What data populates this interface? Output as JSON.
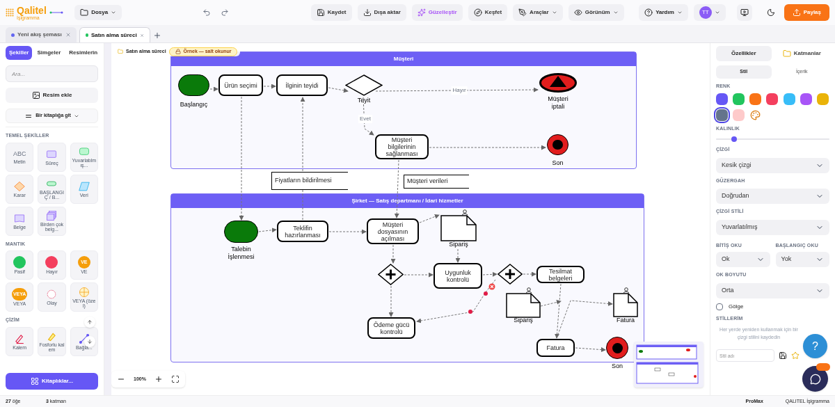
{
  "app": {
    "logo": "Qalitel",
    "logo_sub": "İşigramma"
  },
  "toolbar": {
    "file_menu": "Dosya",
    "actions": [
      {
        "label": "Kaydet",
        "kind": "save",
        "menu": false
      },
      {
        "label": "Dışa aktar",
        "kind": "export",
        "menu": false
      },
      {
        "label": "Güzelleştir",
        "kind": "beautify",
        "menu": false
      },
      {
        "label": "Keşfet",
        "kind": "explore",
        "menu": false
      },
      {
        "label": "Araçlar",
        "kind": "tools",
        "menu": true
      },
      {
        "label": "Görünüm",
        "kind": "view",
        "menu": true
      }
    ],
    "help": "Yardım",
    "avatar": "TT",
    "share": "Paylaş"
  },
  "doc_tabs": [
    {
      "label": "Yeni akış şeması",
      "color": "#6366f1",
      "selected": false
    },
    {
      "label": "Satın alma süreci",
      "color": "#22c55e",
      "selected": true
    }
  ],
  "sidebar": {
    "tabs": [
      {
        "label": "Şekiller",
        "selected": true
      },
      {
        "label": "Simgeler",
        "selected": false
      },
      {
        "label": "Resimlerin",
        "selected": false
      }
    ],
    "search": {
      "placeholder": "Ara..."
    },
    "add_image": "Resim ekle",
    "library_picker": "Bir kitaplığa git",
    "sections": [
      {
        "title": "TEMEL ŞEKİLLER",
        "items": [
          {
            "kind": "text",
            "label": "Metin",
            "glyph": "ABC"
          },
          {
            "kind": "rect",
            "label": "Süreç"
          },
          {
            "kind": "rounded",
            "label": "Yuvarlatılmış..."
          },
          {
            "kind": "diamond",
            "label": "Karar"
          },
          {
            "kind": "terminal",
            "label": "BAŞLANGIÇ / B..."
          },
          {
            "kind": "parallelogram",
            "label": "Veri"
          },
          {
            "kind": "doc",
            "label": "Belge"
          },
          {
            "kind": "multidoc",
            "label": "Birden çok belg..."
          }
        ]
      },
      {
        "title": "MANTIK",
        "items": [
          {
            "kind": "chip",
            "label": "Pasif",
            "color": "#22c55e"
          },
          {
            "kind": "chip",
            "label": "Hayır",
            "color": "#f43f5e"
          },
          {
            "kind": "chip",
            "label": "VE",
            "color": "#f59e0b",
            "glyph": "VE"
          },
          {
            "kind": "chip",
            "label": "VEYA",
            "color": "#f59e0b",
            "glyph": "VEYA"
          },
          {
            "kind": "dashed_circle",
            "label": "Olay"
          },
          {
            "kind": "circle_cross",
            "label": "VEYA (özel)"
          }
        ]
      },
      {
        "title": "ÇİZİM",
        "items": [
          {
            "kind": "pen",
            "label": "Kalem"
          },
          {
            "kind": "highlighter",
            "label": "Fosforlu kalem"
          },
          {
            "kind": "connector",
            "label": "Bağla..."
          }
        ]
      }
    ],
    "libraries": "Kitaplıklar..."
  },
  "canvas": {
    "breadcrumb": "Satın alma süreci",
    "badge": "Örnek — salt okunur",
    "zoom": "100%"
  },
  "diagram": {
    "lanes": [
      {
        "title": "Müşteri"
      },
      {
        "title": "Şirket — Satış departmanı / İdari hizmetler"
      }
    ],
    "nodes": [
      {
        "kind": "start",
        "label": "Başlangıç"
      },
      {
        "kind": "task",
        "label": "Ürün seçimi"
      },
      {
        "kind": "task",
        "label": "İlginin teyidi"
      },
      {
        "kind": "gateway",
        "label": "Teyit"
      },
      {
        "kind": "cancel",
        "label": "Müşteri iptali"
      },
      {
        "kind": "task",
        "label": "Müşteri bilgilerinin sağlanması"
      },
      {
        "kind": "end",
        "label": "Son"
      },
      {
        "kind": "annotation",
        "label": "Fiyatların bildirilmesi"
      },
      {
        "kind": "annotation",
        "label": "Müşteri verileri"
      },
      {
        "kind": "start",
        "label": "Talebin İşlenmesi"
      },
      {
        "kind": "task",
        "label": "Teklifin hazırlanması"
      },
      {
        "kind": "task",
        "label": "Müşteri dosyasının açılması"
      },
      {
        "kind": "document",
        "label": "Sipariş"
      },
      {
        "kind": "parallel"
      },
      {
        "kind": "task",
        "label": "Uygunluk kontrolü"
      },
      {
        "kind": "parallel"
      },
      {
        "kind": "task",
        "label": "Tesilmat belgeleri"
      },
      {
        "kind": "document",
        "label": "Sipariş"
      },
      {
        "kind": "document",
        "label": "Fatura"
      },
      {
        "kind": "task",
        "label": "Ödeme gücü kontrolü"
      },
      {
        "kind": "task",
        "label": "Fatura"
      },
      {
        "kind": "end",
        "label": "Son"
      }
    ],
    "edge_labels": [
      "Hayır",
      "Evet"
    ]
  },
  "panel": {
    "tabs": [
      {
        "label": "Özellikler",
        "selected": true
      },
      {
        "label": "Katmanlar",
        "selected": false
      }
    ],
    "subtabs": [
      {
        "label": "Stil",
        "selected": true
      },
      {
        "label": "İçerik",
        "selected": false
      }
    ],
    "color_title": "RENK",
    "swatches": [
      {
        "color": "#6657f5",
        "selected": false
      },
      {
        "color": "#22c55e",
        "selected": false
      },
      {
        "color": "#f97316",
        "selected": false
      },
      {
        "color": "#f43f5e",
        "selected": false
      },
      {
        "color": "#38bdf8",
        "selected": false
      },
      {
        "color": "#a855f7",
        "selected": false
      },
      {
        "color": "#eab308",
        "selected": false
      },
      {
        "color": "#64748b",
        "selected": true
      },
      {
        "color": "#fecaca",
        "selected": false
      }
    ],
    "thickness": {
      "label": "KALINLIK",
      "level": 0.16
    },
    "line": {
      "label": "ÇİZGİ",
      "value": "Kesik çizgi"
    },
    "route": {
      "label": "GÜZERGAH",
      "value": "Doğrudan"
    },
    "line_style": {
      "label": "ÇİZGİ STİLİ",
      "value": "Yuvarlatılmış"
    },
    "end_arrow": {
      "label": "BİTİŞ OKU",
      "value": "Ok"
    },
    "start_arrow": {
      "label": "BAŞLANGIÇ OKU",
      "value": "Yok"
    },
    "arrow_size": {
      "label": "OK BOYUTU",
      "value": "Orta"
    },
    "shadow": {
      "label": "Gölge",
      "checked": false
    },
    "styles_title": "STİLLERİM",
    "styles_hint": "Her yerde yeniden kullanmak için bir çizgi stilini kaydedin",
    "style_name": {
      "placeholder": "Stil adı"
    }
  },
  "help_button": "?",
  "status_bar": {
    "items": [
      {
        "count": "27",
        "label": "öğe"
      },
      {
        "count": "3",
        "label": "katman"
      }
    ],
    "plan": "ProMax",
    "brand": "QALITEL İşigramma"
  }
}
